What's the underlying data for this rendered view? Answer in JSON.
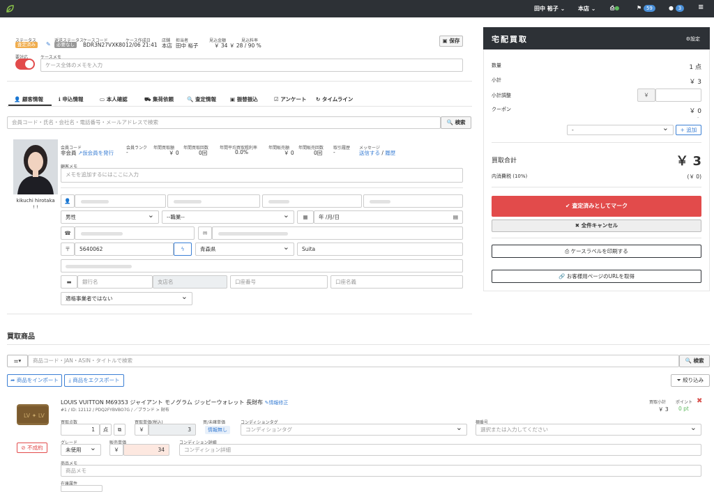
{
  "topbar": {
    "user": "田中 裕子 ⌄",
    "store": "本店 ⌄",
    "flag_count": "59",
    "chat_count": "3"
  },
  "case": {
    "labels": {
      "status": "ステータス",
      "delivery_status": "返送ステータス",
      "case_code": "ケースコード",
      "created": "ケース作成日",
      "store": "店舗",
      "staff": "担当者",
      "estimate_amount": "見込金額",
      "estimate_fee": "見込料率",
      "flagged": "要対応",
      "memo": "ケースメモ"
    },
    "status_badge": "査定済み",
    "delivery_badge": "必要なし",
    "code": "BDR3N27VXK80",
    "created": "12/06 21:41",
    "store": "本店",
    "staff": "田中 裕子",
    "amount": "￥ 34",
    "fee": "￥ 28 / 90 %",
    "save": "保存",
    "memo_placeholder": "ケース全体のメモを入力"
  },
  "tabs": [
    "顧客情報",
    "申込情報",
    "本人確認",
    "集荷依頼",
    "査定情報",
    "振替振込",
    "アンケート",
    "タイムライン"
  ],
  "customer": {
    "search_placeholder": "会員コード・氏名・会社名・電話番号・メールアドレスで検索",
    "search_btn": "検索",
    "name": "kikuchi hirotaka",
    "name_sub": "! !",
    "member_code_label": "会員コード",
    "member_code": "非会員",
    "issue_member": "仮会員を発行",
    "stats": [
      {
        "label": "会員ランク",
        "value": "-"
      },
      {
        "label": "年間買取額",
        "value": "￥ 0"
      },
      {
        "label": "年間買取回数",
        "value": "0回"
      },
      {
        "label": "年間平均買取粗利率",
        "value": "0.0%"
      },
      {
        "label": "年間販売額",
        "value": "￥ 0"
      },
      {
        "label": "年間販売回数",
        "value": "0回"
      },
      {
        "label": "取引履歴",
        "value": "-"
      }
    ],
    "message_label": "メッセージ",
    "message_send": "送信する",
    "message_history": "履歴",
    "memo_label": "顧客メモ",
    "memo_placeholder": "メモを追加するにはここに入力",
    "gender": "男性",
    "occupation": "--職業--",
    "birthday": "年 /月/日",
    "postal": "5640062",
    "prefecture": "青森県",
    "city": "Suita",
    "bank_name": "銀行名",
    "branch_name": "支店名",
    "account_no": "口座番号",
    "account_holder": "口座名義",
    "invoice": "適格事業者ではない"
  },
  "right": {
    "title": "宅配買取",
    "settings": "設定",
    "quantity_label": "数量",
    "quantity": "1 点",
    "subtotal_label": "小計",
    "subtotal": "￥ 3",
    "adjust_label": "小計調整",
    "adjust_prefix": "￥",
    "coupon_label": "クーポン",
    "coupon": "￥ 0",
    "coupon_sub": "-",
    "coupon_select": "-",
    "add": "追加",
    "total_label": "買取合計",
    "total": "￥ 3",
    "tax_label": "内消費税 (10%)",
    "tax": "(￥ 0)",
    "mark_done": "査定済みとしてマーク",
    "cancel_all": "全件キャンセル",
    "print_label": "ケースラベルを印刷する",
    "customer_url": "お客様用ページのURLを取得"
  },
  "items": {
    "heading": "買取商品",
    "search_placeholder": "商品コード・JAN・ASIN・タイトルで検索",
    "search_btn": "検索",
    "import": "商品をインポート",
    "export": "商品をエクスポート",
    "filter": "絞り込み",
    "product": {
      "title": "LOUIS VUITTON M69353 ジャイアント モノグラム ジッピーウォレット 長財布",
      "edit": "情報修正",
      "meta": "#1 / ID: 12112 / PDQ2FYBVBO7G / ／ブランド > 財布",
      "total_label": "買取小計",
      "total": "￥ 3",
      "point_label": "ポイント",
      "point": "0 pt",
      "not_closed": "不成約",
      "qty_label": "買取点数",
      "qty": "1",
      "qty_unit": "点",
      "unit_price_label": "買取単価(税込)",
      "unit_price": "3",
      "info_label": "買/未確単価",
      "info_badge": "情報無し",
      "condition_tag_label": "コンディションタグ",
      "condition_tag_placeholder": "コンディションタグ",
      "shelf_label": "棚番号",
      "shelf_placeholder": "選択または入力してください",
      "grade_label": "グレード",
      "grade": "未使用",
      "sale_price_label": "販売単価",
      "sale_price": "34",
      "condition_detail_label": "コンディション詳細",
      "condition_detail_placeholder": "コンディション詳細",
      "memo_label": "商品メモ",
      "memo_placeholder": "商品メモ",
      "stock_label": "在庫属性"
    }
  },
  "colors": {
    "topbar": "#2d3136",
    "accent_red": "#e24b4b",
    "link_blue": "#3b7fd4",
    "status_yellow": "#f0ad4e"
  }
}
